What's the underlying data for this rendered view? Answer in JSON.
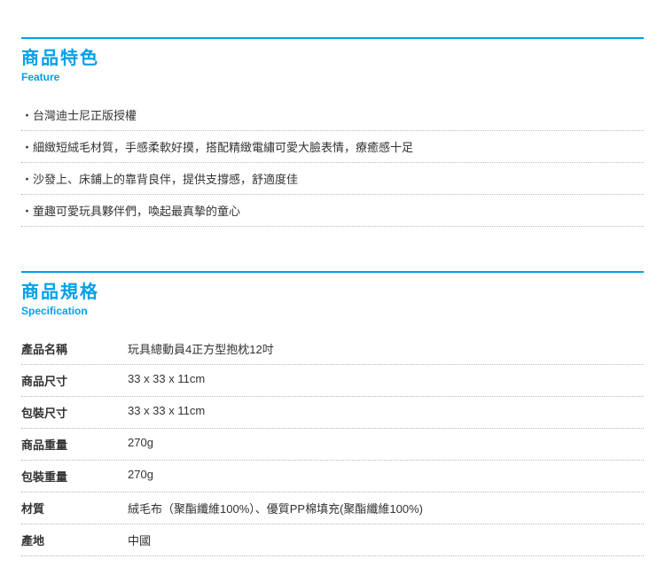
{
  "feature": {
    "title_zh": "商品特色",
    "title_en": "Feature",
    "items": [
      "台灣迪士尼正版授權",
      "細緻短絨毛材質，手感柔軟好摸，搭配精緻電繡可愛大臉表情，療癒感十足",
      "沙發上、床鋪上的靠背良伴，提供支撐感，舒適度佳",
      "童趣可愛玩具夥伴們，喚起最真摯的童心"
    ]
  },
  "spec": {
    "title_zh": "商品規格",
    "title_en": "Specification",
    "rows": [
      {
        "label": "產品名稱",
        "value": "玩具總動員4正方型抱枕12吋"
      },
      {
        "label": "商品尺寸",
        "value": "33 x 33 x 11cm"
      },
      {
        "label": "包裝尺寸",
        "value": "33 x 33 x 11cm"
      },
      {
        "label": "商品重量",
        "value": "270g"
      },
      {
        "label": "包裝重量",
        "value": "270g"
      },
      {
        "label": "材質",
        "value": "絨毛布（聚酯纖維100%）、優質PP棉填充(聚酯纖維100%)"
      },
      {
        "label": "產地",
        "value": "中國"
      }
    ]
  }
}
